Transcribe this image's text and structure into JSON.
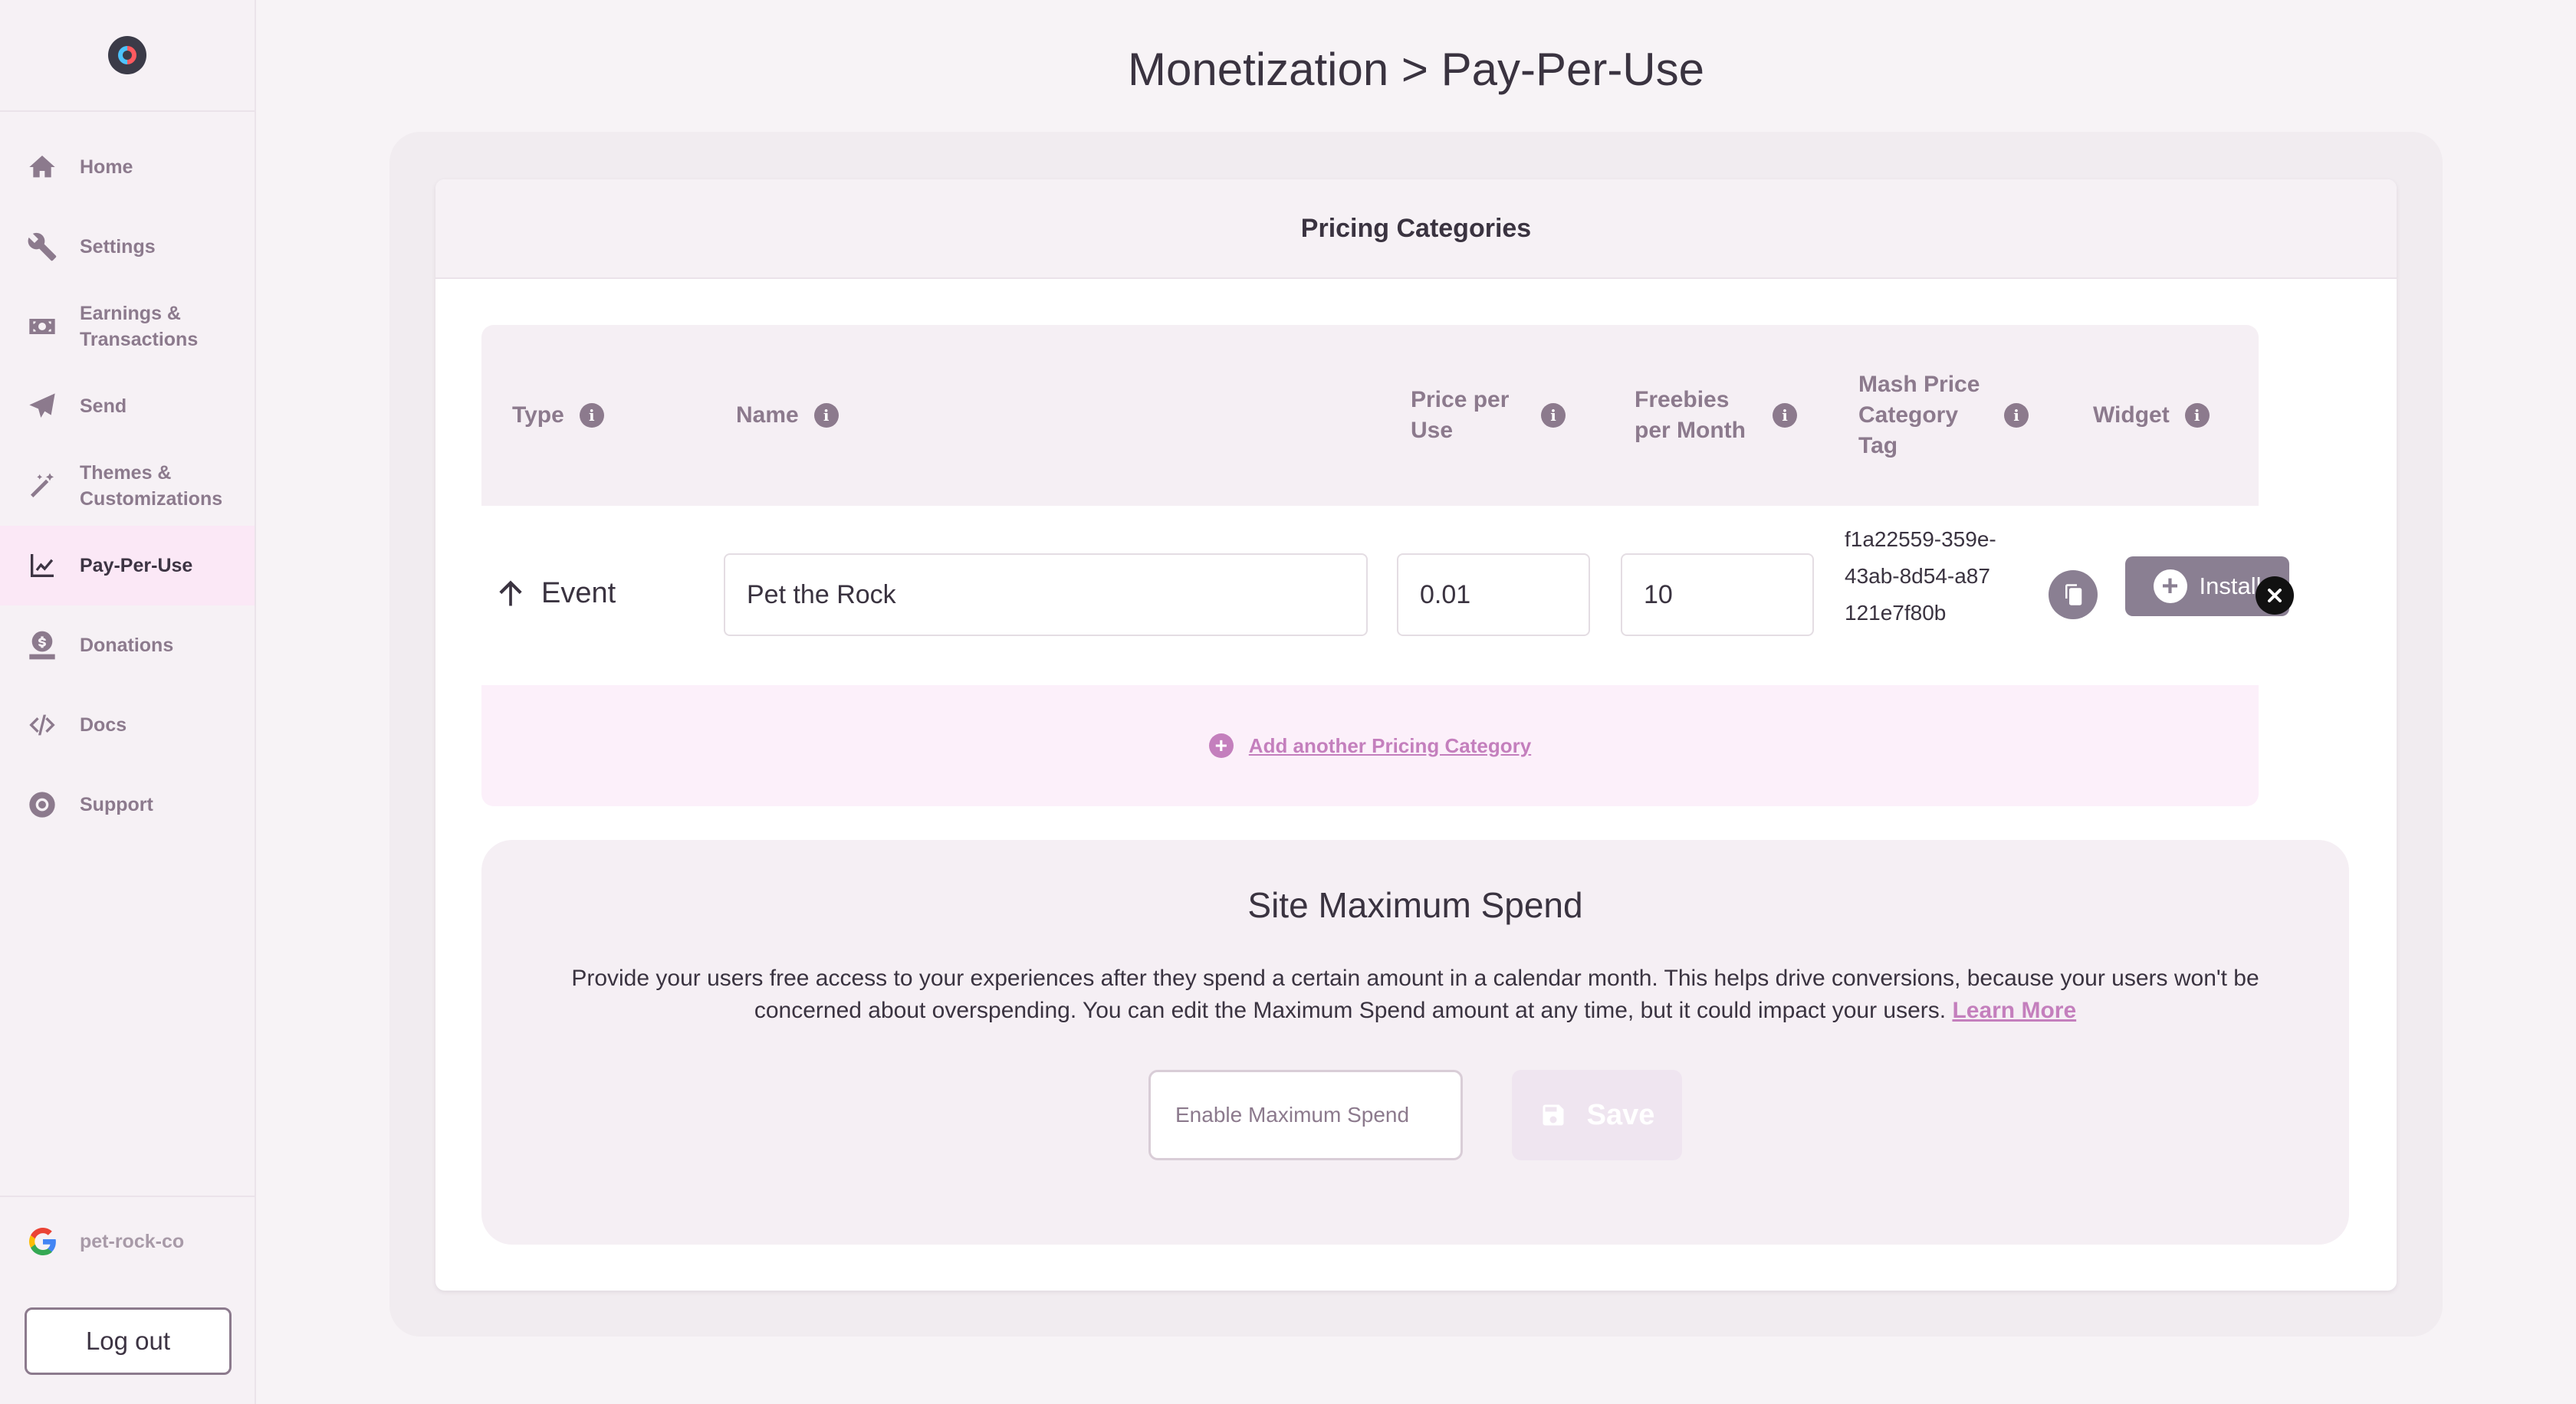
{
  "sidebar": {
    "items": [
      {
        "label": "Home",
        "icon": "home-icon"
      },
      {
        "label": "Settings",
        "icon": "wrench-icon"
      },
      {
        "label": "Earnings & Transactions",
        "icon": "money-icon"
      },
      {
        "label": "Send",
        "icon": "paper-plane-icon"
      },
      {
        "label": "Themes & Customizations",
        "icon": "magic-wand-icon"
      },
      {
        "label": "Pay-Per-Use",
        "icon": "chart-line-icon"
      },
      {
        "label": "Donations",
        "icon": "donate-icon"
      },
      {
        "label": "Docs",
        "icon": "code-icon"
      },
      {
        "label": "Support",
        "icon": "life-ring-icon"
      }
    ],
    "active": "Pay-Per-Use",
    "account": "pet-rock-co",
    "logout_label": "Log out"
  },
  "page": {
    "title": "Monetization > Pay-Per-Use"
  },
  "pricing": {
    "header": "Pricing Categories",
    "columns": {
      "type": "Type",
      "name": "Name",
      "price": "Price per Use",
      "freebies": "Freebies per Month",
      "tag": "Mash Price Category Tag",
      "widget": "Widget"
    },
    "row": {
      "type": "Event",
      "name": "Pet the Rock",
      "price": "0.01",
      "freebies": "10",
      "tag": "f1a22559-359e-43ab-8d54-a87121e7f80b",
      "install_label": "Install"
    },
    "add_label": "Add another Pricing Category"
  },
  "spend": {
    "title": "Site Maximum Spend",
    "description": "Provide your users free access to your experiences after they spend a certain amount in a calendar month. This helps drive conversions, because your users won't be concerned about overspending. You can edit the Maximum Spend amount at any time, but it could impact your users.",
    "learn_more": "Learn More",
    "input_placeholder": "Enable Maximum Spend",
    "save_label": "Save"
  },
  "colors": {
    "accent": "#c47fbd",
    "muted": "#8c7a8d",
    "active_bg": "#fbe8f6"
  }
}
